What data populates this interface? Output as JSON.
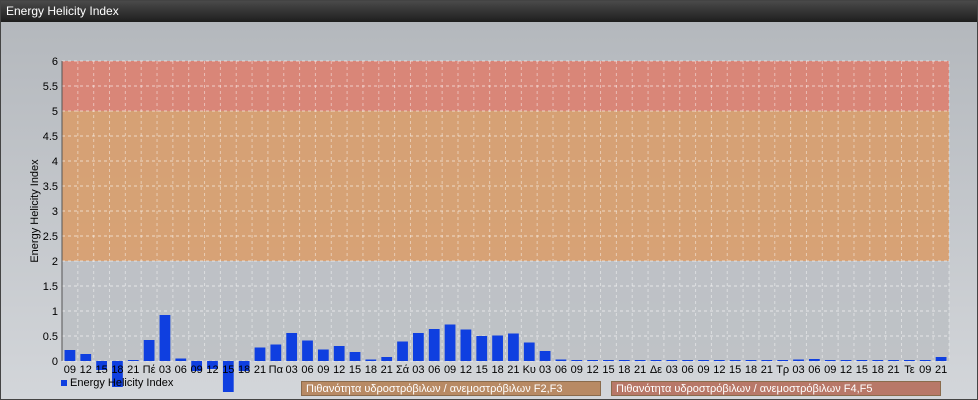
{
  "window": {
    "title": "Energy Helicity Index"
  },
  "chart_data": {
    "type": "bar",
    "ylabel": "Energy Helicity Index",
    "ylim": [
      0,
      6
    ],
    "yticks": [
      "0",
      "0.5",
      "1",
      "1.5",
      "2",
      "2.5",
      "3",
      "3.5",
      "4",
      "4.5",
      "5",
      "5.5",
      "6"
    ],
    "grid": true,
    "legend_position": "bottom-left",
    "series": [
      {
        "name": "Energy Helicity Index",
        "color": "#0f3fe0",
        "values": [
          0.22,
          0.14,
          -0.18,
          -0.52,
          0.02,
          0.42,
          0.92,
          0.05,
          -0.2,
          -0.16,
          -0.62,
          -0.2,
          0.27,
          0.33,
          0.56,
          0.41,
          0.23,
          0.3,
          0.18,
          0.03,
          0.08,
          0.39,
          0.56,
          0.64,
          0.73,
          0.63,
          0.5,
          0.51,
          0.55,
          0.37,
          0.2,
          0.03,
          0.02,
          0.02,
          0.02,
          0.02,
          0.02,
          0.02,
          0.02,
          0.02,
          0.02,
          0.02,
          0.02,
          0.02,
          0.02,
          0.02,
          0.03,
          0.04,
          0.02,
          0.02,
          0.02,
          0.02,
          0.02,
          0.02,
          0.02,
          0.08
        ]
      }
    ],
    "categories": [
      "09",
      "12",
      "15",
      "18",
      "21",
      "Πέ",
      "03",
      "06",
      "09",
      "12",
      "15",
      "18",
      "21",
      "Πα",
      "03",
      "06",
      "09",
      "12",
      "15",
      "18",
      "21",
      "Σά",
      "03",
      "06",
      "09",
      "12",
      "15",
      "18",
      "21",
      "Κυ",
      "03",
      "06",
      "09",
      "12",
      "15",
      "18",
      "21",
      "Δε",
      "03",
      "06",
      "09",
      "12",
      "15",
      "18",
      "21",
      "Τρ",
      "03",
      "06",
      "09",
      "12",
      "15",
      "18",
      "21",
      "Τε",
      "09",
      "21"
    ],
    "bands": [
      {
        "from": 0,
        "to": 2,
        "color": "#bcc0c4"
      },
      {
        "from": 2,
        "to": 5,
        "color": "#d89d6c",
        "label": "Πιθανότητα υδροστρόβιλων / ανεμοστρόβιλων F2,F3"
      },
      {
        "from": 5,
        "to": 6,
        "color": "#dd8070",
        "label": "Πιθανότητα υδροστρόβιλων / ανεμοστρόβιλων F4,F5"
      }
    ]
  }
}
